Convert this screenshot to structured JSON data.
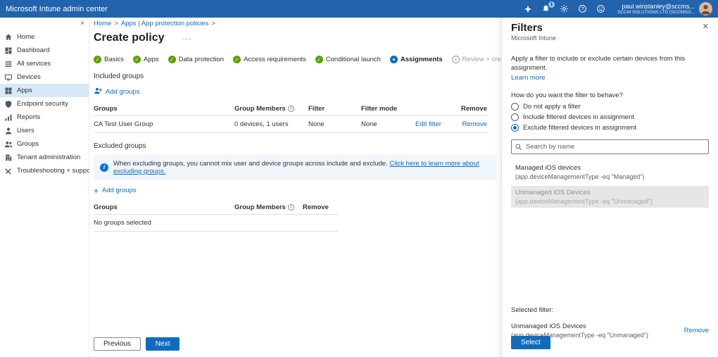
{
  "colors": {
    "accent": "#0f6cbd",
    "topbar": "#2163ac",
    "step_complete": "#57a300",
    "banner_bg": "#eff6fc"
  },
  "icons": {
    "more": "···",
    "close": "✕",
    "collapse": "×",
    "plus": "+",
    "breadcrumb_sep": ">"
  },
  "topbar": {
    "title": "Microsoft Intune admin center",
    "notification_count": "1",
    "user_email": "paul.winstanley@sccms...",
    "user_org": "SCCM SOLUTIONS LTD (SCCMSO..."
  },
  "sidebar": {
    "items": [
      {
        "label": "Home"
      },
      {
        "label": "Dashboard"
      },
      {
        "label": "All services"
      },
      {
        "label": "Devices"
      },
      {
        "label": "Apps"
      },
      {
        "label": "Endpoint security"
      },
      {
        "label": "Reports"
      },
      {
        "label": "Users"
      },
      {
        "label": "Groups"
      },
      {
        "label": "Tenant administration"
      },
      {
        "label": "Troubleshooting + support"
      }
    ]
  },
  "main": {
    "breadcrumb": {
      "home": "Home",
      "section": "Apps | App protection policies"
    },
    "title": "Create policy",
    "steps": [
      {
        "label": "Basics",
        "state": "complete"
      },
      {
        "label": "Apps",
        "state": "complete"
      },
      {
        "label": "Data protection",
        "state": "complete"
      },
      {
        "label": "Access requirements",
        "state": "complete"
      },
      {
        "label": "Conditional launch",
        "state": "complete"
      },
      {
        "label": "Assignments",
        "state": "current"
      },
      {
        "label": "Review + create",
        "state": "upcoming"
      }
    ],
    "included": {
      "heading": "Included groups",
      "add_groups": "Add groups",
      "columns": [
        "Groups",
        "Group Members",
        "Filter",
        "Filter mode",
        "Remove"
      ],
      "row": {
        "group": "CA Test User Group",
        "members": "0 devices, 1 users",
        "filter": "None",
        "filter_mode": "None",
        "edit_filter": "Edit filter",
        "remove": "Remove"
      }
    },
    "excluded": {
      "heading": "Excluded groups",
      "info_text": "When excluding groups, you cannot mix user and device groups across include and exclude.",
      "info_link": "Click here to learn more about excluding groups.",
      "add_groups": "Add groups",
      "columns": [
        "Groups",
        "Group Members",
        "Remove"
      ],
      "empty": "No groups selected"
    },
    "footer": {
      "previous": "Previous",
      "next": "Next"
    }
  },
  "filters": {
    "title": "Filters",
    "subtitle": "Microsoft Intune",
    "description": "Apply a filter to include or exclude certain devices from this assignment.",
    "learn_more": "Learn more",
    "question": "How do you want the filter to behave?",
    "options": [
      {
        "label": "Do not apply a filter",
        "selected": false
      },
      {
        "label": "Include filtered devices in assignment",
        "selected": false
      },
      {
        "label": "Exclude filtered devices in assignment",
        "selected": true
      }
    ],
    "search_placeholder": "Search by name",
    "items": [
      {
        "name": "Managed iOS devices",
        "rule": "(app.deviceManagementType -eq \"Managed\")",
        "disabled": false
      },
      {
        "name": "Unmanaged iOS Devices",
        "rule": "(app.deviceManagementType -eq \"Unmanaged\")",
        "disabled": true
      }
    ],
    "selected_label": "Selected filter:",
    "selected": {
      "name": "Unmanaged iOS Devices",
      "rule": "(app.deviceManagementType -eq \"Unmanaged\")",
      "remove": "Remove"
    },
    "select_button": "Select"
  }
}
